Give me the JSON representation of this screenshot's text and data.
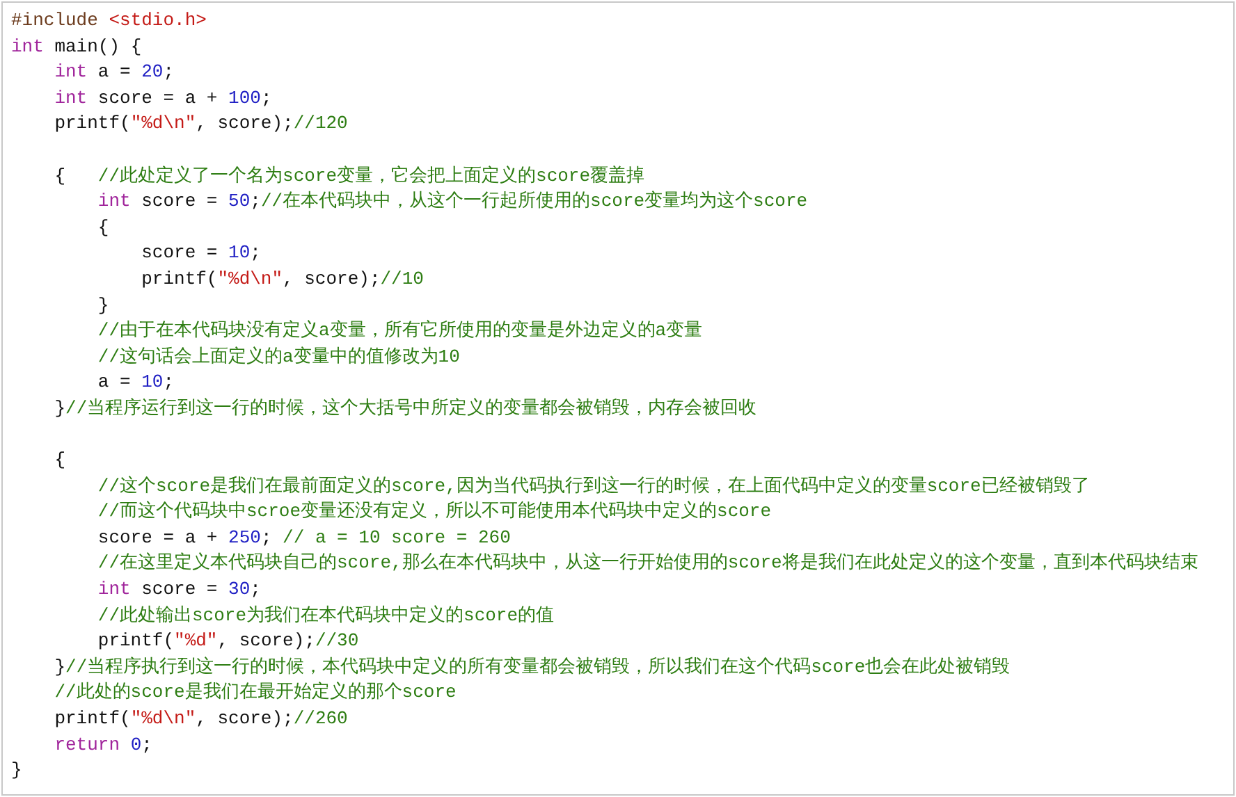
{
  "code": {
    "lines": [
      {
        "kind": "code",
        "tokens": [
          {
            "kind": "preprocessor",
            "text": "#include "
          },
          {
            "kind": "string",
            "text": "<stdio.h>"
          }
        ]
      },
      {
        "kind": "code",
        "tokens": [
          {
            "kind": "keyword",
            "text": "int"
          },
          {
            "kind": "plain",
            "text": " main() {"
          }
        ],
        "children": [
          {
            "kind": "code",
            "tokens": [
              {
                "kind": "keyword",
                "text": "int"
              },
              {
                "kind": "plain",
                "text": " a = "
              },
              {
                "kind": "number",
                "text": "20"
              },
              {
                "kind": "plain",
                "text": ";"
              }
            ]
          },
          {
            "kind": "code",
            "tokens": [
              {
                "kind": "keyword",
                "text": "int"
              },
              {
                "kind": "plain",
                "text": " score = a + "
              },
              {
                "kind": "number",
                "text": "100"
              },
              {
                "kind": "plain",
                "text": ";"
              }
            ]
          },
          {
            "kind": "code",
            "tokens": [
              {
                "kind": "plain",
                "text": "printf("
              },
              {
                "kind": "string",
                "text": "\"%d\\n\""
              },
              {
                "kind": "plain",
                "text": ", score);"
              },
              {
                "kind": "comment",
                "text": "//120"
              }
            ]
          },
          {
            "kind": "blank"
          },
          {
            "kind": "code",
            "tokens": [
              {
                "kind": "plain",
                "text": "{   "
              },
              {
                "kind": "comment",
                "text": "//此处定义了一个名为score变量，它会把上面定义的score覆盖掉"
              }
            ],
            "children": [
              {
                "kind": "code",
                "tokens": [
                  {
                    "kind": "keyword",
                    "text": "int"
                  },
                  {
                    "kind": "plain",
                    "text": " score = "
                  },
                  {
                    "kind": "number",
                    "text": "50"
                  },
                  {
                    "kind": "plain",
                    "text": ";"
                  },
                  {
                    "kind": "comment",
                    "text": "//在本代码块中，从这个一行起所使用的score变量均为这个score"
                  }
                ]
              },
              {
                "kind": "code",
                "tokens": [
                  {
                    "kind": "plain",
                    "text": "{"
                  }
                ],
                "children": [
                  {
                    "kind": "code",
                    "tokens": [
                      {
                        "kind": "plain",
                        "text": "score = "
                      },
                      {
                        "kind": "number",
                        "text": "10"
                      },
                      {
                        "kind": "plain",
                        "text": ";"
                      }
                    ]
                  },
                  {
                    "kind": "code",
                    "tokens": [
                      {
                        "kind": "plain",
                        "text": "printf("
                      },
                      {
                        "kind": "string",
                        "text": "\"%d\\n\""
                      },
                      {
                        "kind": "plain",
                        "text": ", score);"
                      },
                      {
                        "kind": "comment",
                        "text": "//10"
                      }
                    ]
                  }
                ]
              },
              {
                "kind": "code",
                "tokens": [
                  {
                    "kind": "plain",
                    "text": "}"
                  }
                ]
              },
              {
                "kind": "code",
                "tokens": [
                  {
                    "kind": "comment",
                    "text": "//由于在本代码块没有定义a变量，所有它所使用的变量是外边定义的a变量"
                  }
                ]
              },
              {
                "kind": "code",
                "tokens": [
                  {
                    "kind": "comment",
                    "text": "//这句话会上面定义的a变量中的值修改为10"
                  }
                ]
              },
              {
                "kind": "code",
                "tokens": [
                  {
                    "kind": "plain",
                    "text": "a = "
                  },
                  {
                    "kind": "number",
                    "text": "10"
                  },
                  {
                    "kind": "plain",
                    "text": ";"
                  }
                ]
              }
            ]
          },
          {
            "kind": "code",
            "tokens": [
              {
                "kind": "plain",
                "text": "}"
              },
              {
                "kind": "comment",
                "text": "//当程序运行到这一行的时候，这个大括号中所定义的变量都会被销毁，内存会被回收"
              }
            ]
          },
          {
            "kind": "blank"
          },
          {
            "kind": "code",
            "tokens": [
              {
                "kind": "plain",
                "text": "{"
              }
            ],
            "children": [
              {
                "kind": "code",
                "tokens": [
                  {
                    "kind": "comment",
                    "text": "//这个score是我们在最前面定义的score,因为当代码执行到这一行的时候，在上面代码中定义的变量score已经被销毁了"
                  }
                ]
              },
              {
                "kind": "code",
                "tokens": [
                  {
                    "kind": "comment",
                    "text": "//而这个代码块中scroe变量还没有定义，所以不可能使用本代码块中定义的score"
                  }
                ]
              },
              {
                "kind": "code",
                "tokens": [
                  {
                    "kind": "plain",
                    "text": "score = a + "
                  },
                  {
                    "kind": "number",
                    "text": "250"
                  },
                  {
                    "kind": "plain",
                    "text": "; "
                  },
                  {
                    "kind": "comment",
                    "text": "// a = 10 score = 260"
                  }
                ]
              },
              {
                "kind": "code",
                "tokens": [
                  {
                    "kind": "comment",
                    "text": "//在这里定义本代码块自己的score,那么在本代码块中，从这一行开始使用的score将是我们在此处定义的这个变量，直到本代码块结束"
                  }
                ]
              },
              {
                "kind": "code",
                "tokens": [
                  {
                    "kind": "keyword",
                    "text": "int"
                  },
                  {
                    "kind": "plain",
                    "text": " score = "
                  },
                  {
                    "kind": "number",
                    "text": "30"
                  },
                  {
                    "kind": "plain",
                    "text": ";"
                  }
                ]
              },
              {
                "kind": "code",
                "tokens": [
                  {
                    "kind": "comment",
                    "text": "//此处输出score为我们在本代码块中定义的score的值"
                  }
                ]
              },
              {
                "kind": "code",
                "tokens": [
                  {
                    "kind": "plain",
                    "text": "printf("
                  },
                  {
                    "kind": "string",
                    "text": "\"%d\""
                  },
                  {
                    "kind": "plain",
                    "text": ", score);"
                  },
                  {
                    "kind": "comment",
                    "text": "//30"
                  }
                ]
              }
            ]
          },
          {
            "kind": "code",
            "tokens": [
              {
                "kind": "plain",
                "text": "}"
              },
              {
                "kind": "comment",
                "text": "//当程序执行到这一行的时候，本代码块中定义的所有变量都会被销毁，所以我们在这个代码score也会在此处被销毁"
              }
            ]
          },
          {
            "kind": "code",
            "tokens": [
              {
                "kind": "comment",
                "text": "//此处的score是我们在最开始定义的那个score"
              }
            ]
          },
          {
            "kind": "code",
            "tokens": [
              {
                "kind": "plain",
                "text": "printf("
              },
              {
                "kind": "string",
                "text": "\"%d\\n\""
              },
              {
                "kind": "plain",
                "text": ", score);"
              },
              {
                "kind": "comment",
                "text": "//260"
              }
            ]
          },
          {
            "kind": "code",
            "tokens": [
              {
                "kind": "keyword",
                "text": "return "
              },
              {
                "kind": "number",
                "text": "0"
              },
              {
                "kind": "plain",
                "text": ";"
              }
            ]
          }
        ]
      },
      {
        "kind": "code",
        "tokens": [
          {
            "kind": "plain",
            "text": "}"
          }
        ]
      }
    ]
  }
}
